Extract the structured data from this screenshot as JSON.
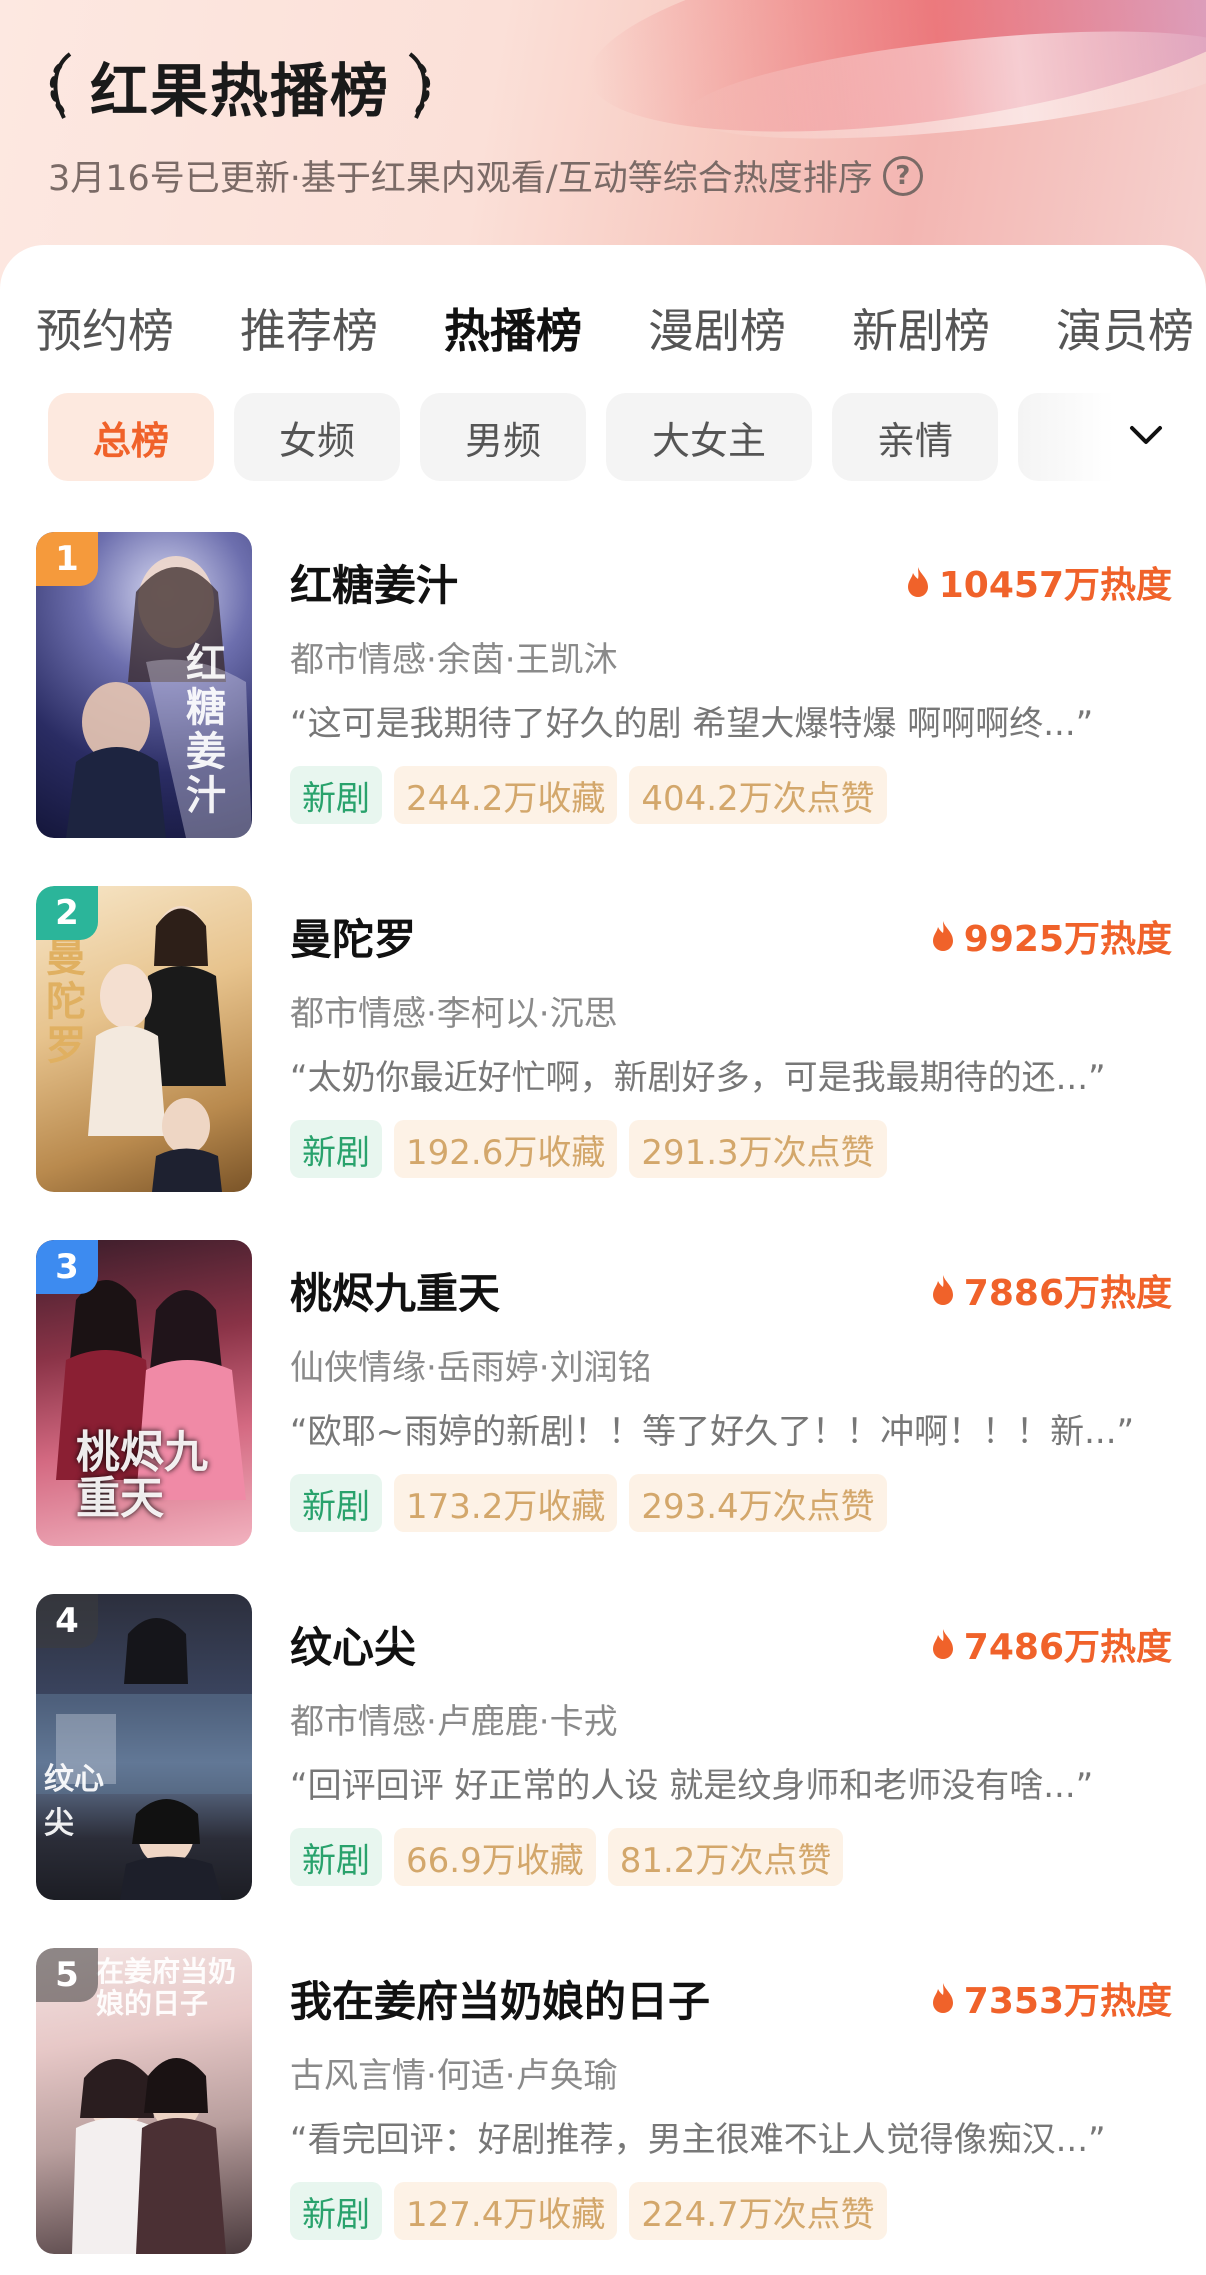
{
  "header": {
    "title": "红果热播榜",
    "subtitle": "3月16号已更新·基于红果内观看/互动等综合热度排序",
    "help_icon": "question-circle-icon"
  },
  "tabs": [
    {
      "label": "预约榜",
      "active": false
    },
    {
      "label": "推荐榜",
      "active": false
    },
    {
      "label": "热播榜",
      "active": true
    },
    {
      "label": "漫剧榜",
      "active": false
    },
    {
      "label": "新剧榜",
      "active": false
    },
    {
      "label": "演员榜",
      "active": false
    }
  ],
  "filters": [
    {
      "label": "总榜",
      "active": true
    },
    {
      "label": "女频",
      "active": false
    },
    {
      "label": "男频",
      "active": false
    },
    {
      "label": "大女主",
      "active": false
    },
    {
      "label": "亲情",
      "active": false
    }
  ],
  "colors": {
    "accent": "#f0622a",
    "new_tag_bg": "#e8f6ef",
    "new_tag_text": "#29a26c",
    "stat_tag_bg": "#fdf2e6",
    "stat_tag_text": "#d3a76b"
  },
  "rankings": [
    {
      "rank": "1",
      "title": "红糖姜汁",
      "heat": "10457万热度",
      "meta": "都市情感·余茵·王凯沐",
      "quote": "“这可是我期待了好久的剧 希望大爆特爆 啊啊啊终...”",
      "badge": "新剧",
      "favorites": "244.2万收藏",
      "likes": "404.2万次点赞",
      "poster_title": "红糖姜汁",
      "rank_color": "#f59a3c"
    },
    {
      "rank": "2",
      "title": "曼陀罗",
      "heat": "9925万热度",
      "meta": "都市情感·李柯以·沉思",
      "quote": "“太奶你最近好忙啊，新剧好多，可是我最期待的还...”",
      "badge": "新剧",
      "favorites": "192.6万收藏",
      "likes": "291.3万次点赞",
      "poster_title": "曼陀罗",
      "rank_color": "#2bb59a"
    },
    {
      "rank": "3",
      "title": "桃烬九重天",
      "heat": "7886万热度",
      "meta": "仙侠情缘·岳雨婷·刘润铭",
      "quote": "“欧耶~雨婷的新剧！！等了好久了！！冲啊！！！新...”",
      "badge": "新剧",
      "favorites": "173.2万收藏",
      "likes": "293.4万次点赞",
      "poster_title": "桃烬九重天",
      "rank_color": "#3d8bf0"
    },
    {
      "rank": "4",
      "title": "纹心尖",
      "heat": "7486万热度",
      "meta": "都市情感·卢鹿鹿·卡戎",
      "quote": "“回评回评 好正常的人设 就是纹身师和老师没有啥...”",
      "badge": "新剧",
      "favorites": "66.9万收藏",
      "likes": "81.2万次点赞",
      "poster_title": "纹心尖",
      "rank_color": "rgba(60,60,60,0.55)"
    },
    {
      "rank": "5",
      "title": "我在姜府当奶娘的日子",
      "heat": "7353万热度",
      "meta": "古风言情·何适·卢奂瑜",
      "quote": "“看完回评：好剧推荐，男主很难不让人觉得像痴汉...”",
      "badge": "新剧",
      "favorites": "127.4万收藏",
      "likes": "224.7万次点赞",
      "poster_title": "在姜府当奶娘的日子",
      "rank_color": "rgba(60,60,60,0.55)"
    }
  ]
}
